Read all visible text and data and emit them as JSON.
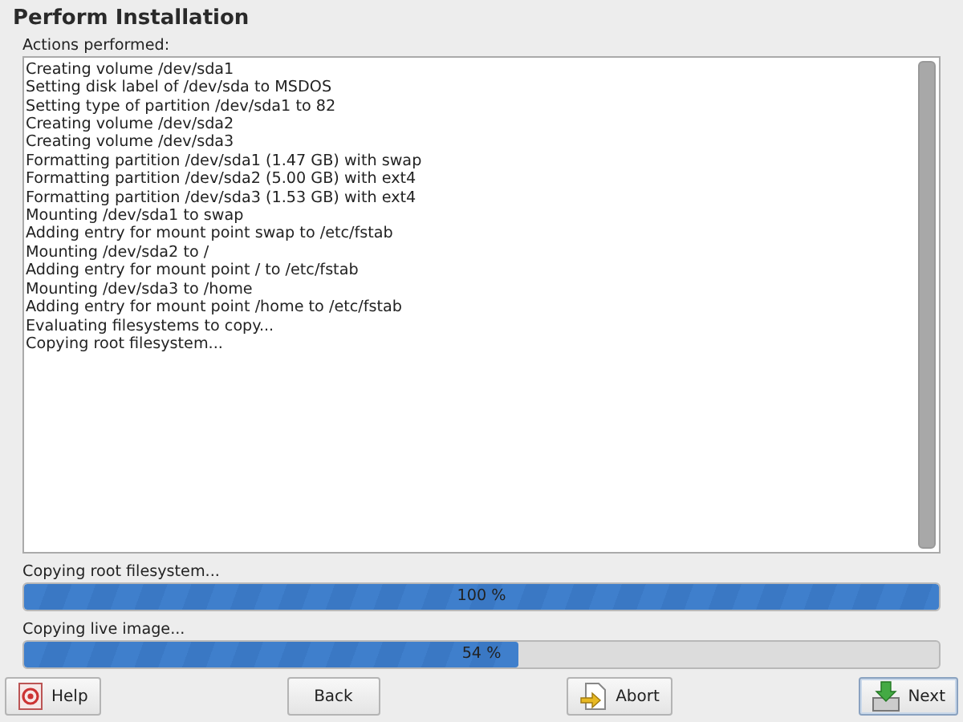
{
  "title": "Perform Installation",
  "log": {
    "label": "Actions performed:",
    "lines": [
      "Creating volume /dev/sda1",
      "Setting disk label of /dev/sda to MSDOS",
      "Setting type of partition /dev/sda1 to 82",
      "Creating volume /dev/sda2",
      "Creating volume /dev/sda3",
      "Formatting partition /dev/sda1 (1.47 GB) with swap",
      "Formatting partition /dev/sda2 (5.00 GB) with ext4",
      "Formatting partition /dev/sda3 (1.53 GB) with ext4",
      "Mounting /dev/sda1 to swap",
      "Adding entry for mount point swap to /etc/fstab",
      "Mounting /dev/sda2 to /",
      "Adding entry for mount point / to /etc/fstab",
      "Mounting /dev/sda3 to /home",
      "Adding entry for mount point /home to /etc/fstab",
      "Evaluating filesystems to copy...",
      "Copying root filesystem..."
    ]
  },
  "progress": [
    {
      "label": "Copying root filesystem...",
      "level": 1.0,
      "reading": "100 %"
    },
    {
      "label": "Copying live image...",
      "level": 0.54,
      "reading": "54 %"
    }
  ],
  "buttons": [
    {
      "label": "Help",
      "kind": "help",
      "focused": false
    },
    {
      "label": "Back",
      "kind": "back",
      "focused": false
    },
    {
      "label": "Abort",
      "kind": "abort",
      "focused": false
    },
    {
      "label": "Next",
      "kind": "next",
      "focused": true
    }
  ]
}
